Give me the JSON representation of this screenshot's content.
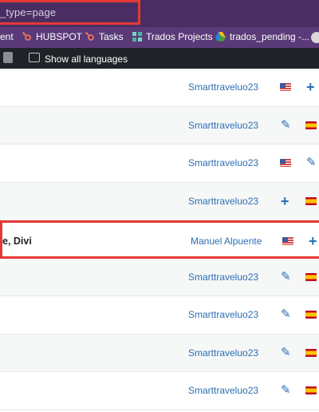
{
  "url_bar": {
    "text": "_type=page"
  },
  "bookmarks": [
    {
      "label": "ent",
      "icon": ""
    },
    {
      "label": "HUBSPOT",
      "icon": "hubspot-icon"
    },
    {
      "label": "Tasks",
      "icon": "hubspot-icon"
    },
    {
      "label": "Trados Projects",
      "icon": "trados-icon"
    },
    {
      "label": "trados_pending -...",
      "icon": "drive-icon"
    }
  ],
  "admin_bar": {
    "show_all_languages": "Show all languages"
  },
  "rows": [
    {
      "title": "",
      "author": "Smarttraveluo23",
      "col1": "flag-us",
      "col2": "plus"
    },
    {
      "title": "",
      "author": "Smarttraveluo23",
      "col1": "pencil",
      "col2": "flag-es"
    },
    {
      "title": "",
      "author": "Smarttraveluo23",
      "col1": "flag-us",
      "col2": "pencil"
    },
    {
      "title": "",
      "author": "Smarttraveluo23",
      "col1": "plus",
      "col2": "flag-es"
    },
    {
      "title": "e, Divi",
      "author": "Manuel Alpuente",
      "col1": "flag-us",
      "col2": "plus",
      "highlight": true
    },
    {
      "title": "",
      "author": "Smarttraveluo23",
      "col1": "pencil",
      "col2": "flag-es"
    },
    {
      "title": "",
      "author": "Smarttraveluo23",
      "col1": "pencil",
      "col2": "flag-es"
    },
    {
      "title": "",
      "author": "Smarttraveluo23",
      "col1": "pencil",
      "col2": "flag-es"
    },
    {
      "title": "",
      "author": "Smarttraveluo23",
      "col1": "pencil",
      "col2": "flag-es"
    }
  ],
  "colors": {
    "accent": "#2b6fb4",
    "highlight": "#e53935",
    "header": "#4a2e63"
  }
}
